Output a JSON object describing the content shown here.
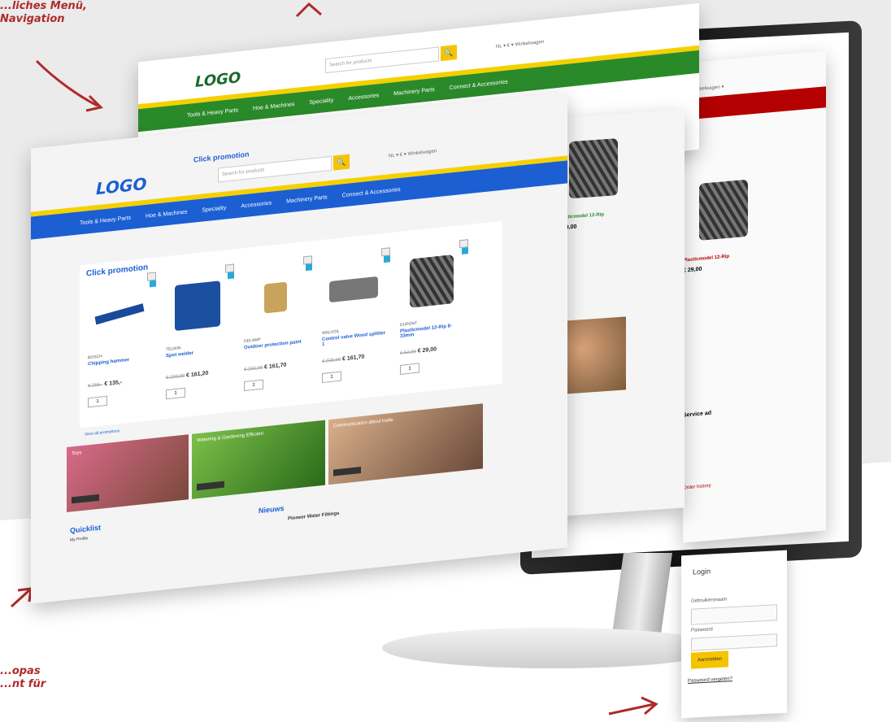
{
  "annotations": {
    "menu": "...liches Menü,\nNavigation",
    "europe": "...opas\n...nt für"
  },
  "green_site": {
    "logo": "LOGO",
    "search_placeholder": "Search for products",
    "topbar": "NL ▾  € ▾  Winkelwagen",
    "nav": [
      "Tools & Heavy Parts",
      "Hoe & Machines",
      "Speciality",
      "Accessories",
      "Machinery Parts",
      "Connect & Accessories"
    ]
  },
  "front_site": {
    "logo": "LOGO",
    "search_placeholder": "Search for products",
    "topbar": "NL ▾  € ▾  Winkelwagen",
    "header_text": "Click promotion",
    "nav": [
      "Tools & Heavy Parts",
      "Hoe & Machines",
      "Speciality",
      "Accessories",
      "Machinery Parts",
      "Connect & Accessories"
    ],
    "promotion_title": "Click promotion",
    "products": [
      {
        "brand": "BOSCH",
        "name": "Chipping hammer",
        "old_price": "€ 255,-",
        "price": "€ 135,-",
        "qty": "1"
      },
      {
        "brand": "TELWIN",
        "name": "Spot welder",
        "old_price": "€ 229,00",
        "price": "€ 161,20",
        "qty": "1"
      },
      {
        "brand": "DELAMP",
        "name": "Outdoor protection paint",
        "old_price": "€ 222,00",
        "price": "€ 161,70",
        "qty": "1"
      },
      {
        "brand": "WALVOIL",
        "name": "Control valve Wood splitter 1",
        "old_price": "€ 225,00",
        "price": "€ 161,70",
        "qty": "1"
      },
      {
        "brand": "DUPONT",
        "name": "Plasticmodel 12-Rip 8-33mm",
        "old_price": "€ 52,00",
        "price": "€ 29,00",
        "qty": "1"
      }
    ],
    "view_all": "View all promotions",
    "banners": [
      "Toys",
      "Watering & Gardening Efficient",
      "Communication about trade"
    ],
    "quicklist_title": "Quicklist",
    "quicklist_sub": "My Profile",
    "news_title": "Nieuws",
    "news_item": "Pioneer Water Fittings"
  },
  "mid_site": {
    "product_name": "Plasticmodel 12-Rip",
    "price": "€ 29,00"
  },
  "red_site": {
    "topbar": "Winkelwagen ▾",
    "product_name": "Plasticmodel 12-Rip",
    "price": "€ 29,00",
    "side_title": "Service ad",
    "link": "Order history"
  },
  "login": {
    "title": "Login",
    "username_label": "Gebruikersnaam",
    "password_label": "Paswoord",
    "button": "Aanmelden",
    "forgot": "Paswoord vergeten?"
  },
  "colors": {
    "green": "#2a8a2a",
    "blue": "#1b5fd3",
    "red": "#b40000",
    "yellow": "#f5d000",
    "annotation": "#b02a2a"
  }
}
